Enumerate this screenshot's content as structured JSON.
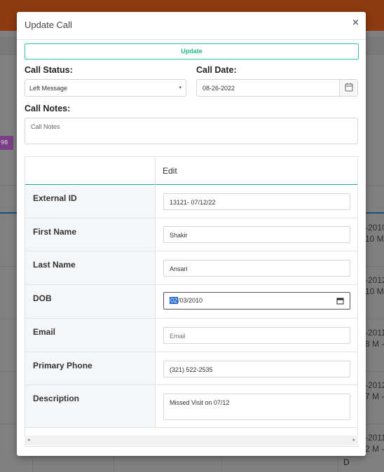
{
  "background": {
    "badge_text": "98",
    "right_column_lines": [
      {
        "top": "-2010",
        "bottom": "10 M"
      },
      {
        "top": "-2012",
        "bottom": "10 M"
      },
      {
        "top": "-2011",
        "bottom": "8 M -"
      },
      {
        "top": "-2012",
        "bottom": "7 M -"
      },
      {
        "top": "-2011",
        "bottom": "2 M -"
      }
    ],
    "bottom_letter": "D"
  },
  "modal": {
    "title": "Update Call",
    "close_label": "×",
    "update_label": "Update",
    "call_status": {
      "label": "Call Status:",
      "value": "Left Message"
    },
    "call_date": {
      "label": "Call Date:",
      "value": "08-26-2022"
    },
    "call_notes": {
      "label": "Call Notes:",
      "placeholder": "Call Notes"
    },
    "table": {
      "header_edit": "Edit",
      "rows": [
        {
          "label": "External ID",
          "value": "13121- 07/12/22"
        },
        {
          "label": "First Name",
          "value": "Shakir"
        },
        {
          "label": "Last Name",
          "value": "Ansari"
        },
        {
          "label": "DOB",
          "value_highlight": "02",
          "value_rest": "/03/2010"
        },
        {
          "label": "Email",
          "placeholder": "Email"
        },
        {
          "label": "Primary Phone",
          "value": "(321) 522-2535"
        },
        {
          "label": "Description",
          "value": "Missed Visit on 07/12"
        }
      ]
    },
    "scroll_left": "◂",
    "scroll_right": "▸"
  },
  "icons": {
    "select_caret": "▾"
  }
}
